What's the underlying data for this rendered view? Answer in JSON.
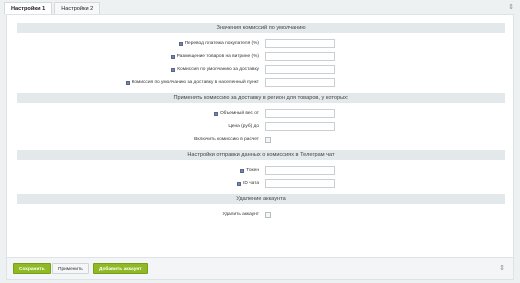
{
  "tabs": [
    {
      "label": "Настройки 1"
    },
    {
      "label": "Настройки 2"
    }
  ],
  "sections": {
    "commission_defaults": {
      "title": "Значения комиссий по умолчанию",
      "fields": [
        {
          "label": "Перевод платежа покупателя (%)",
          "value": ""
        },
        {
          "label": "Размещение товаров на витрине (%)",
          "value": ""
        },
        {
          "label": "Комиссия по умолчанию за доставку",
          "value": ""
        },
        {
          "label": "Комиссия по умолчанию за доставку в населенный пункт",
          "value": ""
        }
      ]
    },
    "delivery_region": {
      "title": "Применять комиссию за доставку в регион для товаров, у которых:",
      "fields": [
        {
          "label": "Объемный вес от",
          "value": ""
        },
        {
          "label": "Цена (руб) до",
          "value": ""
        }
      ],
      "checkbox_label": "Включить комиссию в расчет"
    },
    "telegram": {
      "title": "Настройки отправки данных о комиссиях в Телеграм чат",
      "fields": [
        {
          "label": "Токен",
          "value": ""
        },
        {
          "label": "ID чата",
          "value": ""
        }
      ]
    },
    "account_delete": {
      "title": "Удаление аккаунта",
      "checkbox_label": "Удалить аккаунт"
    }
  },
  "footer": {
    "save_label": "Сохранить",
    "apply_label": "Применить",
    "add_account_label": "Добавить аккаунт"
  },
  "colors": {
    "accent_green": "#8fb925",
    "section_header": "#e3e8ea",
    "help_icon": "#7a86a8"
  }
}
